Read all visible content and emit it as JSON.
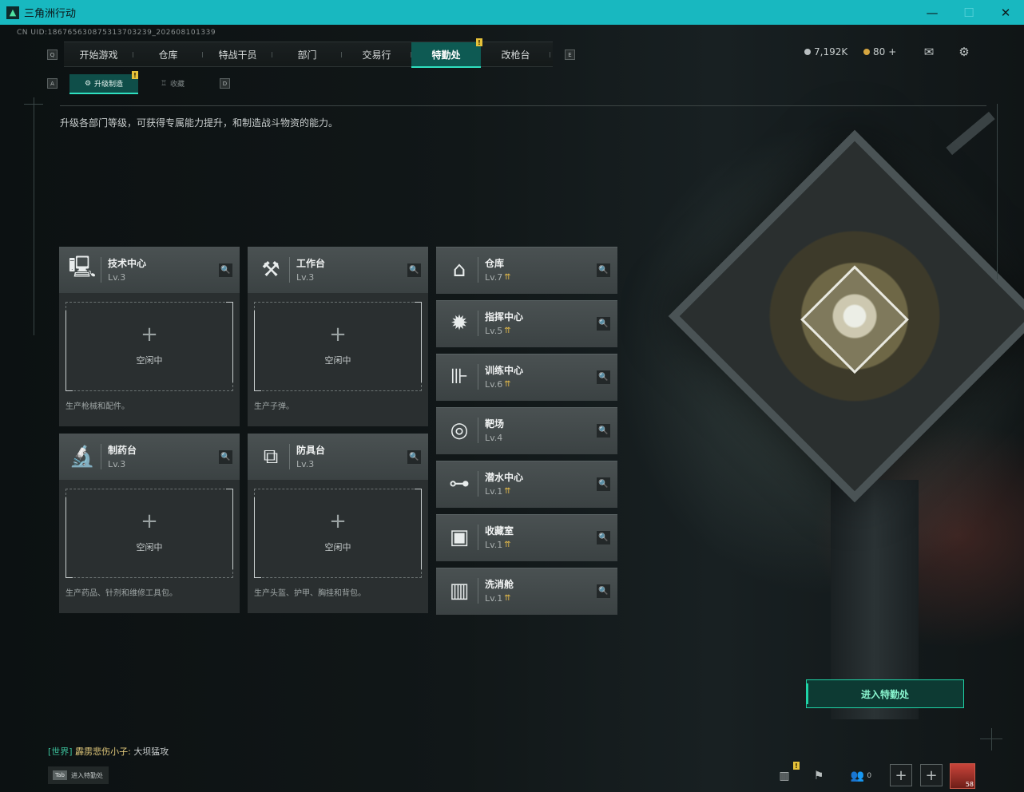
{
  "window": {
    "title": "三角洲行动",
    "minimize": "—",
    "maximize": "☐",
    "close": "✕"
  },
  "uid": "CN UID:18676563087531370323​9_202608101339",
  "nav": {
    "left_key": "Q",
    "right_key": "E",
    "tabs": [
      "开始游戏",
      "仓库",
      "特战干员",
      "部门",
      "交易行",
      "特勤处",
      "改枪台"
    ],
    "active_index": 5,
    "badge": "!"
  },
  "currency": {
    "silver": "7,192K",
    "gold": "80",
    "gold_add": "+"
  },
  "subnav": {
    "left_key": "A",
    "right_key": "D",
    "tabs": [
      "升级制造",
      "收藏"
    ],
    "badge": "!"
  },
  "description": "升级各部门等级，可获得专属能力提升，和制造战斗物资的能力。",
  "slot_idle": "空闲中",
  "slot_plus": "+",
  "production": [
    {
      "name": "技术中心",
      "level": "Lv.3",
      "icon": "monitor-icon",
      "desc": "生产枪械和配件。"
    },
    {
      "name": "工作台",
      "level": "Lv.3",
      "icon": "tools-icon",
      "desc": "生产子弹。"
    },
    {
      "name": "制药台",
      "level": "Lv.3",
      "icon": "microscope-icon",
      "desc": "生产药品、针剂和维修工具包。"
    },
    {
      "name": "防具台",
      "level": "Lv.3",
      "icon": "cubes-icon",
      "desc": "生产头盔、护甲、胸挂和背包。"
    }
  ],
  "departments": [
    {
      "name": "仓库",
      "level": "Lv.7",
      "icon": "warehouse-icon",
      "upgradable": true
    },
    {
      "name": "指挥中心",
      "level": "Lv.5",
      "icon": "chip-icon",
      "upgradable": true
    },
    {
      "name": "训练中心",
      "level": "Lv.6",
      "icon": "dumbbell-icon",
      "upgradable": true
    },
    {
      "name": "靶场",
      "level": "Lv.4",
      "icon": "target-icon",
      "upgradable": false
    },
    {
      "name": "潜水中心",
      "level": "Lv.1",
      "icon": "diving-mask-icon",
      "upgradable": true
    },
    {
      "name": "收藏室",
      "level": "Lv.1",
      "icon": "collection-icon",
      "upgradable": true
    },
    {
      "name": "洗消舱",
      "level": "Lv.1",
      "icon": "decon-icon",
      "upgradable": true
    }
  ],
  "enter_button": "进入特勤处",
  "chat": {
    "channel": "[世界]",
    "name": "霹雳悲伤小子:",
    "message": "大坝猛攻"
  },
  "tab_hint": {
    "key": "Tab",
    "label": "进入特勤处"
  },
  "bottom": {
    "friends_count": "0",
    "avatar_level": "58",
    "badge": "!"
  },
  "colors": {
    "accent": "#2fe0c0",
    "titlebar": "#18b8c0",
    "upgrade": "#e0b84a"
  }
}
